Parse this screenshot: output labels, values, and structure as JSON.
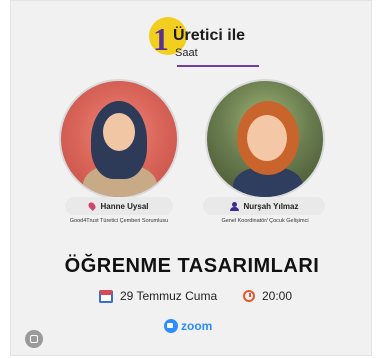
{
  "logo": {
    "number": "1",
    "line1": "Üretici ile",
    "line2": "Saat"
  },
  "speakers": [
    {
      "name": "Hanne Uysal",
      "role": "Good4Trust Türetici Çemberi Sorumlusu",
      "icon": "location-pin-icon"
    },
    {
      "name": "Nurşah Yılmaz",
      "role": "Genel Koordinatör/ Çocuk Gelişimci",
      "icon": "user-icon"
    }
  ],
  "event": {
    "title": "ÖĞRENME TASARIMLARI",
    "date": "29 Temmuz Cuma",
    "time": "20:00",
    "platform": "zoom"
  },
  "colors": {
    "accent_purple": "#58338f",
    "yellow": "#f2cf1f",
    "zoom_blue": "#2d8cff"
  }
}
